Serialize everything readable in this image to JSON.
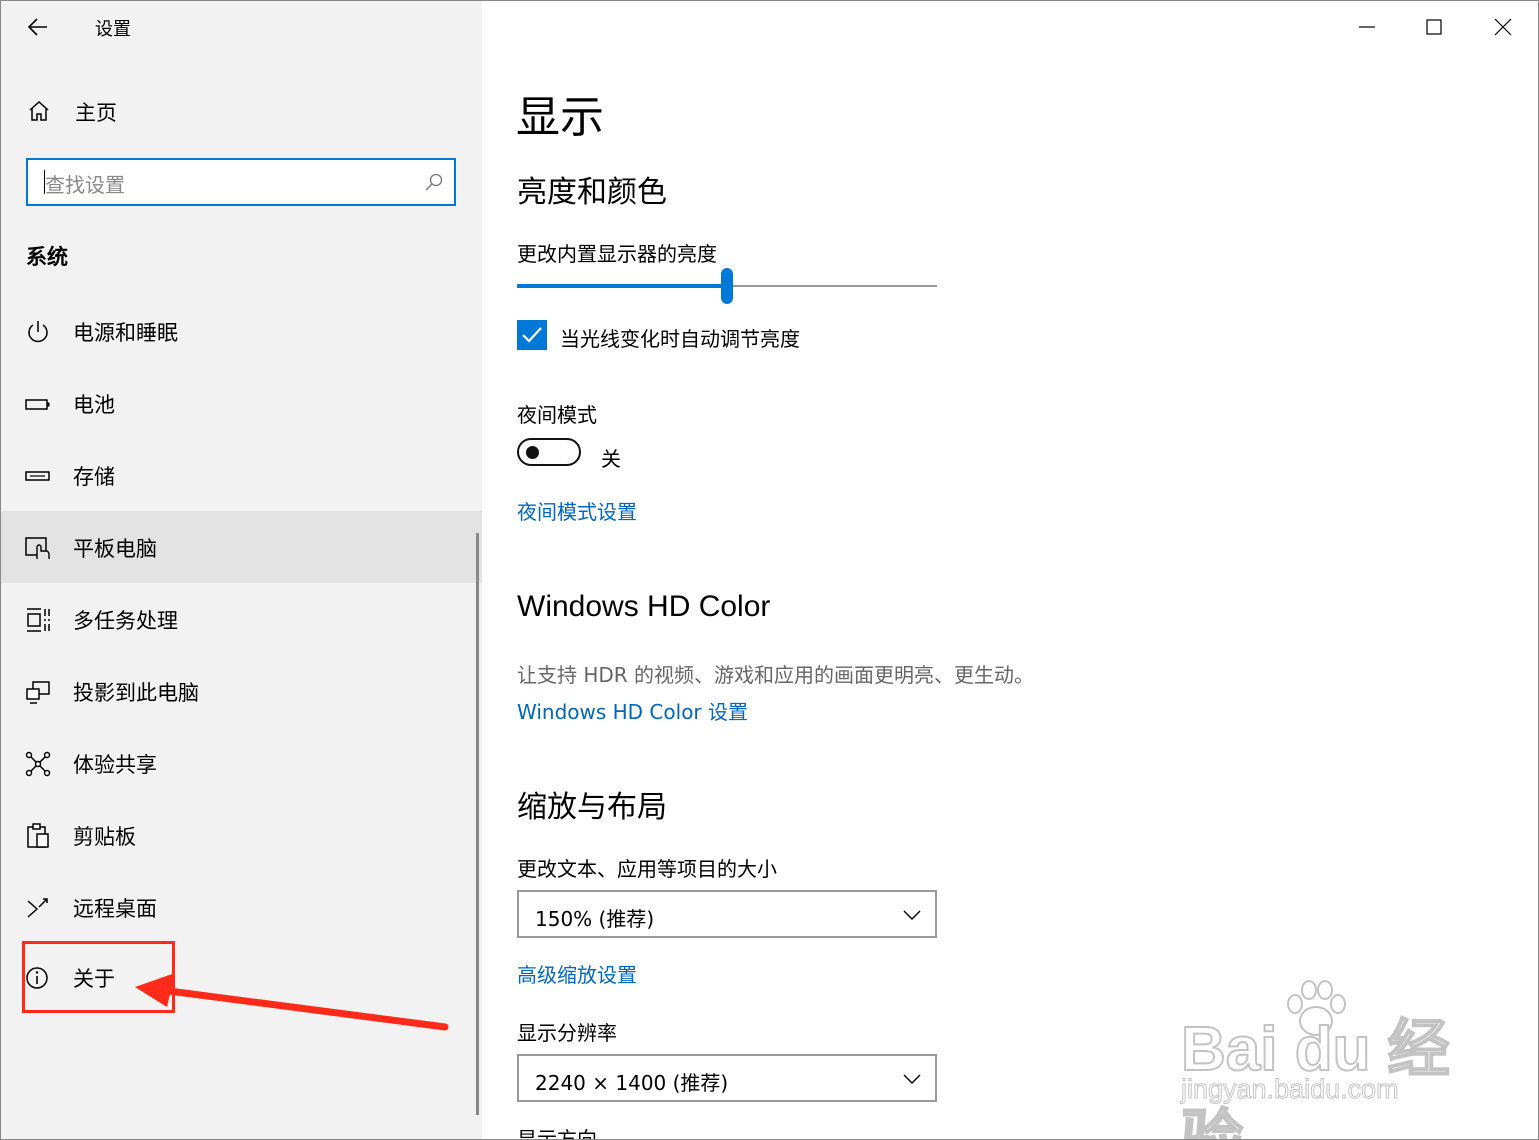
{
  "app_title": "设置",
  "home_label": "主页",
  "search": {
    "placeholder": "查找设置"
  },
  "section_title": "系统",
  "nav_items": [
    {
      "label": "电源和睡眠",
      "icon": "power-icon"
    },
    {
      "label": "电池",
      "icon": "battery-icon"
    },
    {
      "label": "存储",
      "icon": "storage-icon"
    },
    {
      "label": "平板电脑",
      "icon": "tablet-icon",
      "selected": true
    },
    {
      "label": "多任务处理",
      "icon": "multitasking-icon"
    },
    {
      "label": "投影到此电脑",
      "icon": "project-icon"
    },
    {
      "label": "体验共享",
      "icon": "share-icon"
    },
    {
      "label": "剪贴板",
      "icon": "clipboard-icon"
    },
    {
      "label": "远程桌面",
      "icon": "remote-desktop-icon"
    },
    {
      "label": "关于",
      "icon": "info-icon"
    }
  ],
  "main": {
    "title": "显示",
    "brightness": {
      "heading": "亮度和颜色",
      "slider_label": "更改内置显示器的亮度",
      "slider_value": 0.5,
      "auto_checkbox_label": "当光线变化时自动调节亮度",
      "auto_checked": true
    },
    "night_mode": {
      "label": "夜间模式",
      "state": "关",
      "settings_link": "夜间模式设置"
    },
    "hdr": {
      "heading": "Windows HD Color",
      "description": "让支持 HDR 的视频、游戏和应用的画面更明亮、更生动。",
      "link": "Windows HD Color 设置"
    },
    "scale": {
      "heading": "缩放与布局",
      "size_label": "更改文本、应用等项目的大小",
      "size_value": "150% (推荐)",
      "advanced_link": "高级缩放设置",
      "resolution_label": "显示分辨率",
      "resolution_value": "2240 × 1400 (推荐)",
      "orientation_label": "显示方向"
    }
  },
  "watermark": {
    "line1": "Bai du 经验",
    "line2": "jingyan.baidu.com"
  },
  "colors": {
    "accent": "#0078d7",
    "link": "#0067c0",
    "annotation": "#ff2a1a"
  }
}
